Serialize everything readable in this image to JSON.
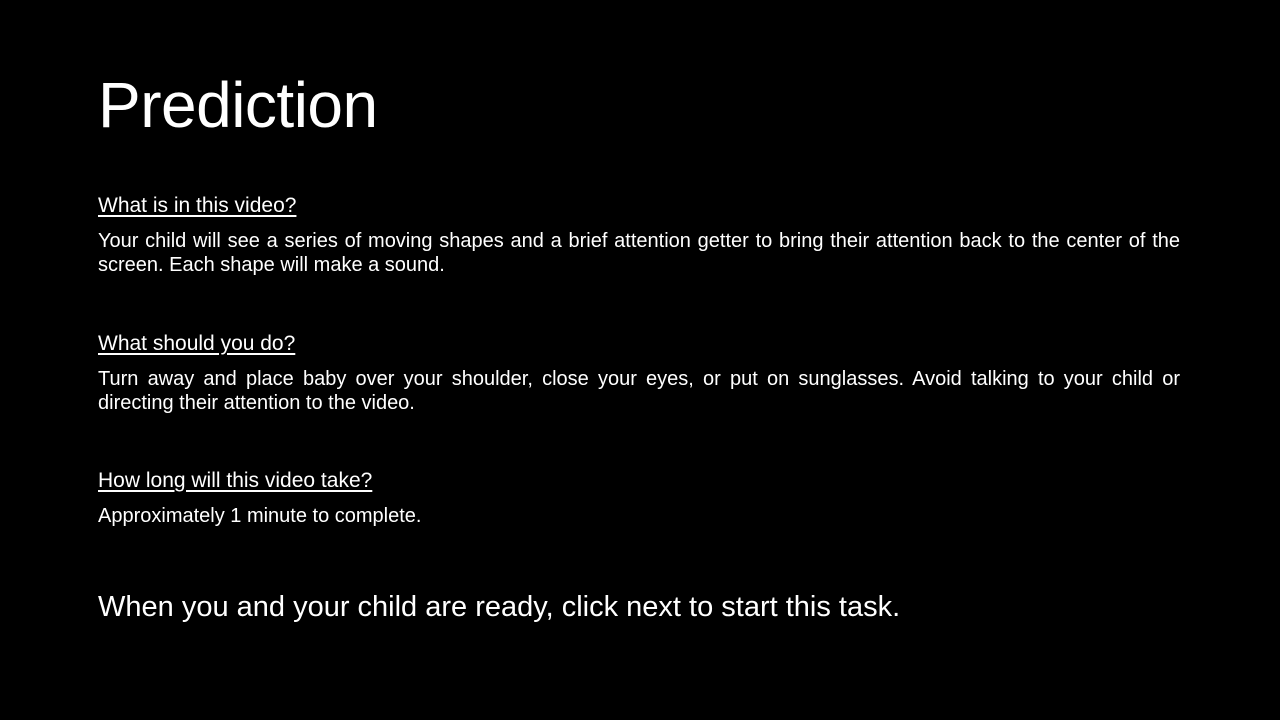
{
  "slide": {
    "title": "Prediction",
    "sections": [
      {
        "heading": "What is in this video?",
        "body": "Your child will see a series of moving shapes and a brief attention getter to bring their attention back to the center of the screen. Each shape will make a sound."
      },
      {
        "heading": "What should you do?",
        "body": "Turn away and place baby over your shoulder, close your eyes, or put on sunglasses. Avoid talking to your child or directing their attention to the video."
      },
      {
        "heading": "How long will this video take?",
        "body": "Approximately 1 minute to complete."
      }
    ],
    "call_to_action": "When you and your child are ready, click next to start this task."
  },
  "colors": {
    "background": "#000000",
    "text": "#ffffff"
  }
}
